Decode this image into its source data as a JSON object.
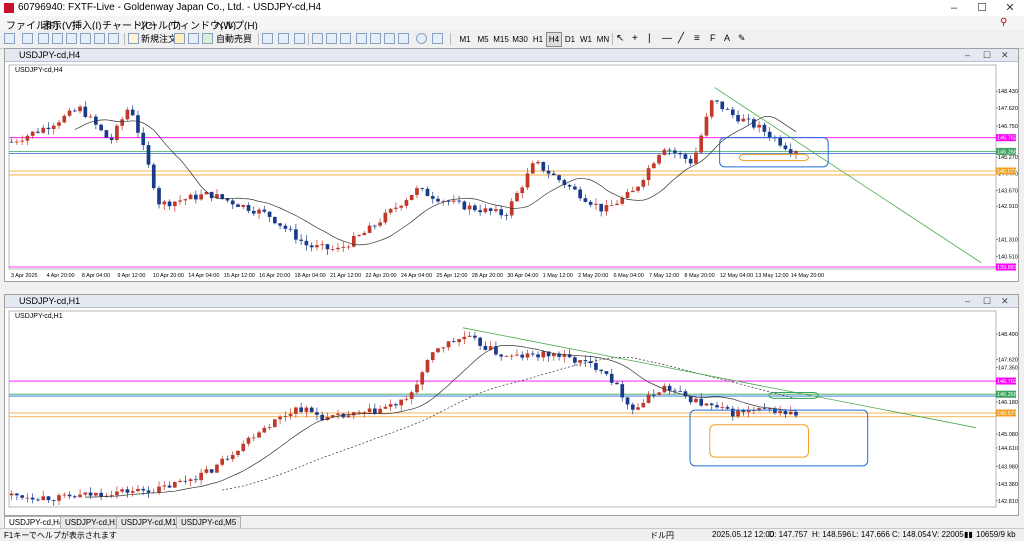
{
  "window": {
    "title": "60796940: FXTF-Live - Goldenway Japan Co., Ltd. - USDJPY-cd,H4"
  },
  "menu": [
    "ファイル(F)",
    "表示(V)",
    "挿入(I)",
    "チャート(C)",
    "ツール(T)",
    "ウィンドウ(W)",
    "ヘルプ(H)"
  ],
  "toolbar": {
    "new_order": "新規注文",
    "auto_trade": "自動売買",
    "timeframes": [
      "M1",
      "M5",
      "M15",
      "M30",
      "H1",
      "H4",
      "D1",
      "W1",
      "MN"
    ],
    "active_timeframe": "H4"
  },
  "chart_data": [
    {
      "type": "candlestick",
      "symbol": "USDJPY-cd,H4",
      "title": "USDJPY-cd,H4",
      "y_ticks": [
        148.43,
        147.62,
        146.75,
        145.27,
        144.47,
        143.67,
        142.91,
        141.31,
        140.51
      ],
      "ylim": [
        139.9,
        149.3
      ],
      "x_ticks": [
        "3 Apr 2025",
        "4 Apr 20:00",
        "8 Apr 04:00",
        "9 Apr 12:00",
        "10 Apr 20:00",
        "14 Apr 04:00",
        "15 Apr 12:00",
        "16 Apr 20:00",
        "18 Apr 04:00",
        "21 Apr 12:00",
        "22 Apr 20:00",
        "24 Apr 04:00",
        "25 Apr 12:00",
        "28 Apr 20:00",
        "30 Apr 04:00",
        "1 May 12:00",
        "2 May 20:00",
        "6 May 04:00",
        "7 May 12:00",
        "8 May 20:00",
        "12 May 04:00",
        "13 May 12:00",
        "14 May 20:00"
      ],
      "price_tags": [
        {
          "label": "146.762",
          "color": "#ff00ff"
        },
        {
          "label": "146.268",
          "color": "#3aa35b"
        },
        {
          "label": "145.577",
          "color": "#f0a020"
        },
        {
          "label": "139.883",
          "color": "#ff00ff"
        }
      ],
      "grid": false
    },
    {
      "type": "candlestick",
      "symbol": "USDJPY-cd,H1",
      "title": "USDJPY-cd,H1",
      "y_ticks": [
        148.49,
        147.62,
        147.35,
        146.18,
        145.08,
        144.61,
        143.98,
        143.38,
        142.81
      ],
      "ylim": [
        142.6,
        149.0
      ],
      "price_tags": [
        {
          "label": "146.762",
          "color": "#ff00ff"
        },
        {
          "label": "146.268",
          "color": "#3aa35b"
        },
        {
          "label": "145.577",
          "color": "#f0a020"
        }
      ],
      "grid": false
    }
  ],
  "tabs": [
    "USDJPY-cd,H4",
    "USDJPY-cd,H1",
    "USDJPY-cd,M15",
    "USDJPY-cd,M5"
  ],
  "active_tab": "USDJPY-cd,H4",
  "status": {
    "help": "F1キーでヘルプが表示されます",
    "profile": "ドル円",
    "datetime": "2025.05.12 12:00",
    "open": "O: 147.757",
    "high": "H: 148.596",
    "low": "L: 147.666",
    "close": "C: 148.054",
    "volume": "V: 22005",
    "traffic": "10659/9 kb"
  }
}
